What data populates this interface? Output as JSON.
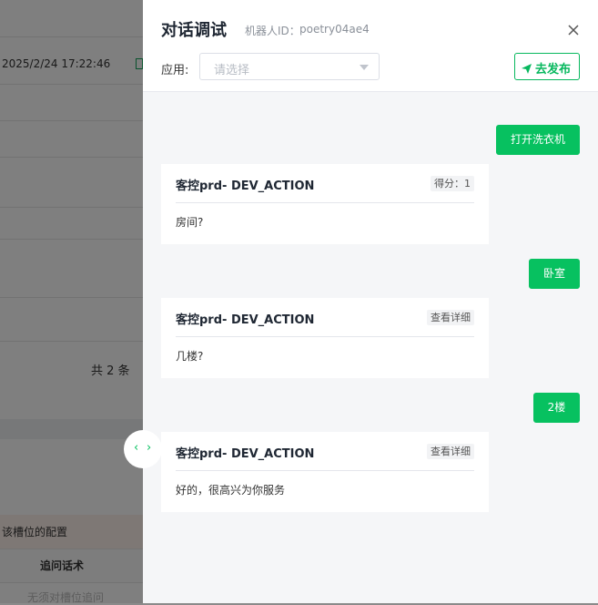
{
  "background": {
    "timestamp": "2025/2/24 17:22:46",
    "total_text": "共 2 条",
    "warning_text": "该槽位的配置",
    "column_header": "追问话术",
    "empty_text": "无须对槽位追问"
  },
  "drawer": {
    "title": "对话调试",
    "bot_id_label": "机器人ID：",
    "bot_id_value": "poetry04ae4",
    "app_label": "应用:",
    "app_placeholder": "请选择",
    "publish_label": "去发布"
  },
  "conversation": [
    {
      "role": "user",
      "text": "打开洗衣机"
    },
    {
      "role": "bot",
      "name": "客控prd- DEV_ACTION",
      "tag": "得分：1",
      "text": "房间?"
    },
    {
      "role": "user",
      "text": "卧室"
    },
    {
      "role": "bot",
      "name": "客控prd- DEV_ACTION",
      "tag": "查看详细",
      "text": "几楼?"
    },
    {
      "role": "user",
      "text": "2楼"
    },
    {
      "role": "bot",
      "name": "客控prd- DEV_ACTION",
      "tag": "查看详细",
      "text": "好的，很高兴为你服务"
    }
  ],
  "colors": {
    "accent": "#07c160",
    "mask": "rgba(0,0,0,0.5)"
  },
  "icons": {
    "close": "close-icon",
    "publish": "paper-plane-icon",
    "select": "chevron-down-icon",
    "toggle_left": "chevron-left-icon",
    "toggle_right": "chevron-right-icon"
  }
}
